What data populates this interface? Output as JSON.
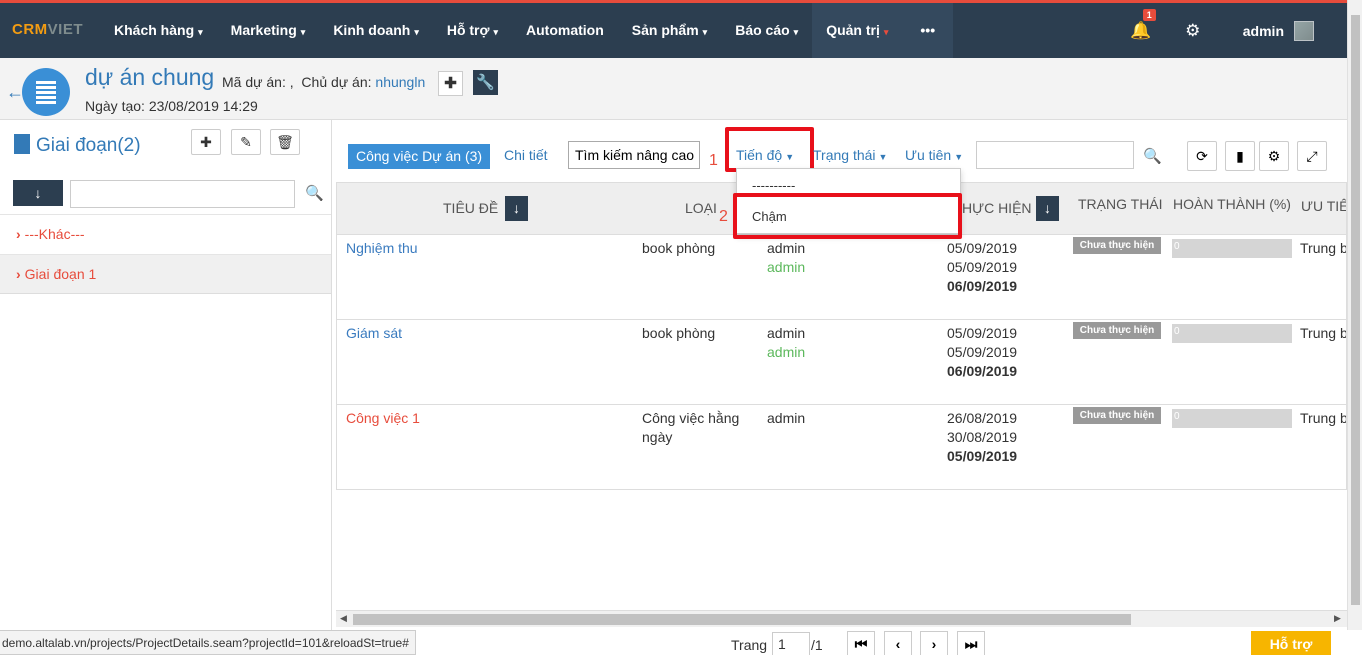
{
  "topnav": {
    "logo_main": "CRM",
    "logo_sub": "VIET",
    "items": [
      {
        "label": "Khách hàng",
        "caret": "▾"
      },
      {
        "label": "Marketing",
        "caret": "▾"
      },
      {
        "label": "Kinh doanh",
        "caret": "▾"
      },
      {
        "label": "Hỗ trợ",
        "caret": "▾"
      },
      {
        "label": "Automation",
        "caret": ""
      },
      {
        "label": "Sản phẩm",
        "caret": "▾"
      },
      {
        "label": "Báo cáo",
        "caret": "▾"
      },
      {
        "label": "Quản trị",
        "caret": "▾"
      }
    ],
    "more": "•••",
    "notification_count": "1",
    "user": "admin"
  },
  "project": {
    "title": "dự án chung",
    "code_label": "Mã dự án: ,",
    "owner_label": "Chủ dự án:",
    "owner": "nhungln",
    "created": "Ngày tạo: 23/08/2019 14:29"
  },
  "phases": {
    "title": "Giai đoạn(2)",
    "items": [
      "---Khác---",
      "Giai đoạn 1"
    ]
  },
  "toolbar": {
    "tab": "Công việc Dự án (3)",
    "detail": "Chi tiết",
    "advanced_search": "Tìm kiếm nâng cao",
    "progress_filter": "Tiến độ",
    "status_filter": "Trạng thái",
    "priority_filter": "Ưu tiên",
    "annotation_1": "1",
    "annotation_2": "2"
  },
  "dropdown": {
    "options": [
      "----------",
      "Chậm"
    ]
  },
  "table": {
    "headers": {
      "title": "TIÊU ĐỀ",
      "type": "LOẠI",
      "date": "HỰC HIỆN",
      "status": "TRẠNG THÁI",
      "complete": "HOÀN THÀNH (%)",
      "priority": "ƯU TIÊ"
    },
    "rows": [
      {
        "title": "Nghiệm thu",
        "type": "book phòng",
        "assignee": "admin",
        "assignee2": "admin",
        "d1": "05/09/2019",
        "d2": "05/09/2019",
        "d3": "06/09/2019",
        "status": "Chưa thực hiện",
        "percent": "0",
        "priority": "Trung b"
      },
      {
        "title": "Giám sát",
        "type": "book phòng",
        "assignee": "admin",
        "assignee2": "admin",
        "d1": "05/09/2019",
        "d2": "05/09/2019",
        "d3": "06/09/2019",
        "status": "Chưa thực hiện",
        "percent": "0",
        "priority": "Trung b"
      },
      {
        "title": "Công việc 1",
        "type": "Công việc hằng ngày",
        "assignee": "admin",
        "assignee2": "",
        "d1": "26/08/2019",
        "d2": "30/08/2019",
        "d3": "05/09/2019",
        "status": "Chưa thực hiện",
        "percent": "0",
        "priority": "Trung b"
      }
    ]
  },
  "pagination": {
    "label": "Trang",
    "current": "1",
    "total": "/1"
  },
  "footer": {
    "url": "demo.altalab.vn/projects/ProjectDetails.seam?projectId=101&reloadSt=true#",
    "help": "Hỗ trợ"
  }
}
